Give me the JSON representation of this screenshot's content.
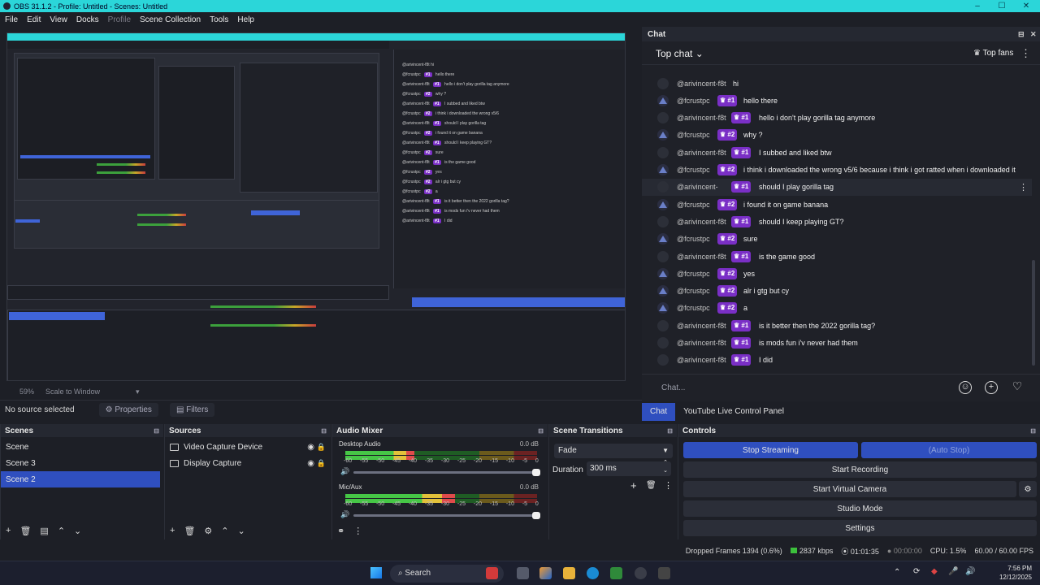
{
  "window": {
    "title": "OBS 31.1.2 - Profile: Untitled - Scenes: Untitled"
  },
  "menu": [
    "File",
    "Edit",
    "View",
    "Docks",
    "Profile",
    "Scene Collection",
    "Tools",
    "Help"
  ],
  "preview_status": {
    "zoom": "59%",
    "scale_mode": "Scale to Window"
  },
  "source_toolbar": {
    "no_source": "No source selected",
    "properties": "Properties",
    "filters": "Filters"
  },
  "scenes": {
    "title": "Scenes",
    "items": [
      "Scene",
      "Scene 3",
      "Scene 2"
    ],
    "selected": "Scene 2"
  },
  "sources": {
    "title": "Sources",
    "items": [
      {
        "name": "Video Capture Device",
        "icon": "camera-icon"
      },
      {
        "name": "Display Capture",
        "icon": "monitor-icon"
      }
    ]
  },
  "mixer": {
    "title": "Audio Mixer",
    "channels": [
      {
        "name": "Desktop Audio",
        "db": "0.0 dB",
        "level": 0.36
      },
      {
        "name": "Mic/Aux",
        "db": "0.0 dB",
        "level": 0.57
      }
    ],
    "ticks": [
      "-60",
      "-55",
      "-50",
      "-45",
      "-40",
      "-35",
      "-30",
      "-25",
      "-20",
      "-15",
      "-10",
      "-5",
      "0"
    ]
  },
  "transitions": {
    "title": "Scene Transitions",
    "selected": "Fade",
    "duration_label": "Duration",
    "duration": "300 ms"
  },
  "controls": {
    "title": "Controls",
    "stop_streaming": "Stop Streaming",
    "auto_stop": "(Auto Stop)",
    "start_recording": "Start Recording",
    "start_virtual_camera": "Start Virtual Camera",
    "studio_mode": "Studio Mode",
    "settings": "Settings"
  },
  "status": {
    "dropped_frames": "Dropped Frames 1394 (0.6%)",
    "bitrate": "2837 kbps",
    "stream_time": "01:01:35",
    "rec_time": "00:00:00",
    "cpu": "CPU: 1.5%",
    "fps": "60.00 / 60.00 FPS"
  },
  "chat": {
    "dock_title": "Chat",
    "mode": "Top chat",
    "top_fans": "Top fans",
    "input_placeholder": "Chat...",
    "tabs": [
      "Chat",
      "YouTube Live Control Panel"
    ],
    "messages": [
      {
        "user": "@arivincent-f8t",
        "badge": "",
        "text": "hi",
        "avatar": "grey"
      },
      {
        "user": "@fcrustpc",
        "badge": "#1",
        "text": "hello there",
        "avatar": "purple"
      },
      {
        "user": "@arivincent-f8t",
        "badge": "#1",
        "text": "hello i don't play gorilla tag anymore",
        "avatar": "grey"
      },
      {
        "user": "@fcrustpc",
        "badge": "#2",
        "text": "why ?",
        "avatar": "purple"
      },
      {
        "user": "@arivincent-f8t",
        "badge": "#1",
        "text": "I subbed and liked btw",
        "avatar": "grey"
      },
      {
        "user": "@fcrustpc",
        "badge": "#2",
        "text": "i think i downloaded the wrong v5/6 because i think i got ratted when i downloaded it",
        "avatar": "purple"
      },
      {
        "user": "@arivincent-",
        "badge": "#1",
        "text": "should I play gorilla tag",
        "avatar": "grey"
      },
      {
        "user": "@fcrustpc",
        "badge": "#2",
        "text": "i found it on game banana",
        "avatar": "purple"
      },
      {
        "user": "@arivincent-f8t",
        "badge": "#1",
        "text": "should I keep playing GT?",
        "avatar": "grey"
      },
      {
        "user": "@fcrustpc",
        "badge": "#2",
        "text": "sure",
        "avatar": "purple"
      },
      {
        "user": "@arivincent-f8t",
        "badge": "#1",
        "text": "is the game good",
        "avatar": "grey"
      },
      {
        "user": "@fcrustpc",
        "badge": "#2",
        "text": "yes",
        "avatar": "purple"
      },
      {
        "user": "@fcrustpc",
        "badge": "#2",
        "text": "alr i gtg but cy",
        "avatar": "purple"
      },
      {
        "user": "@fcrustpc",
        "badge": "#2",
        "text": "a",
        "avatar": "purple"
      },
      {
        "user": "@arivincent-f8t",
        "badge": "#1",
        "text": "is it better then the 2022 gorilla tag?",
        "avatar": "grey"
      },
      {
        "user": "@arivincent-f8t",
        "badge": "#1",
        "text": "is mods fun i'v never had them",
        "avatar": "grey"
      },
      {
        "user": "@arivincent-f8t",
        "badge": "#1",
        "text": "I did",
        "avatar": "grey"
      }
    ]
  },
  "taskbar": {
    "search": "Search",
    "time": "7:56 PM",
    "date": "12/12/2025"
  }
}
